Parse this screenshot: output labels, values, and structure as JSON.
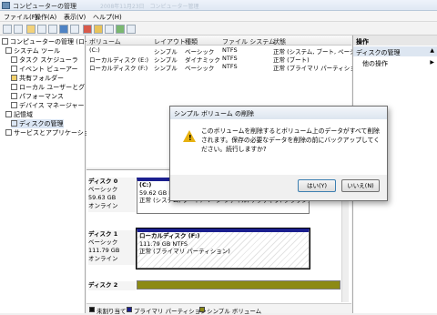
{
  "window": {
    "title": "コンピューターの管理",
    "ghost_title": "2008年11月23日　コンピューター管理"
  },
  "menu": [
    "ファイル(F)",
    "操作(A)",
    "表示(V)",
    "ヘルプ(H)"
  ],
  "tree": [
    "コンピューターの管理 (ローカ",
    "システム ツール",
    "タスク スケジューラ",
    "イベント ビューアー",
    "共有フォルダー",
    "ローカル ユーザーとグ",
    "パフォーマンス",
    "デバイス マネージャー",
    "記憶域",
    "ディスクの管理",
    "サービスとアプリケーショ"
  ],
  "list": {
    "columns": [
      "ボリューム",
      "レイアウト",
      "種類",
      "ファイル システム",
      "状態"
    ],
    "rows": [
      [
        "(C:)",
        "シンプル",
        "ベーシック",
        "NTFS",
        "正常 (システム, ブート, ページ"
      ],
      [
        "ローカルディスク (E:)",
        "シンプル",
        "ダイナミック",
        "NTFS",
        "正常 (ブート)"
      ],
      [
        "ローカルディスク (F:)",
        "シンプル",
        "ベーシック",
        "NTFS",
        "正常 (プライマリ パーティショ"
      ]
    ]
  },
  "disks": [
    {
      "name": "ディスク 0",
      "type": "ベーシック",
      "size": "59.63 GB",
      "status": "オンライン",
      "vol_name": "(C:)",
      "vol_size": "59.62 GB NTFS",
      "vol_status": "正常 (システム, ブート, ページ ファイル, アクティブ, クラッシュ"
    },
    {
      "name": "ディスク 1",
      "type": "ベーシック",
      "size": "111.79 GB",
      "status": "オンライン",
      "vol_name": "ローカルディスク (F:)",
      "vol_size": "111.79 GB NTFS",
      "vol_status": "正常 (プライマリ パーティション)"
    },
    {
      "name": "ディスク 2"
    }
  ],
  "legend": [
    "未割り当て",
    "プライマリ パーティション",
    "シンプル ボリューム"
  ],
  "actions": {
    "header": "操作",
    "disk_mgmt": "ディスクの管理",
    "other": "他の操作"
  },
  "dialog": {
    "title": "シンプル ボリューム の削除",
    "message": "このボリュームを削除するとボリューム上のデータがすべて削除されます。保存の必要なデータを削除の前にバックアップしてください。続行しますか?",
    "yes": "はい(Y)",
    "no": "いいえ(N)"
  },
  "colors": {
    "unallocated": "#111111",
    "primary": "#1b1f8f",
    "simple": "#8c8a14"
  }
}
